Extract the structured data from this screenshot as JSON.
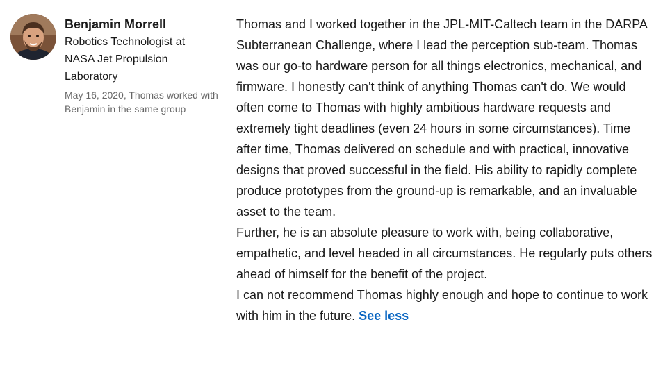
{
  "recommender": {
    "name": "Benjamin Morrell",
    "headline": "Robotics Technologist at NASA Jet Propulsion Laboratory",
    "meta": "May 16, 2020, Thomas worked with Benjamin in the same group",
    "avatar_icon": "profile-photo"
  },
  "recommendation": {
    "paragraphs": [
      "Thomas and I worked together in the JPL-MIT-Caltech team in the DARPA Subterranean Challenge, where I lead the perception sub-team. Thomas was our go-to hardware person for all things electronics, mechanical, and firmware. I honestly can't think of anything Thomas can't do. We would often come to Thomas with highly ambitious hardware requests and extremely tight deadlines (even 24 hours in some circumstances). Time after time, Thomas delivered on schedule and with practical, innovative designs that proved successful in the field. His ability to rapidly complete produce prototypes from the ground-up is remarkable, and an invaluable asset to the team.",
      "Further, he is an absolute pleasure to work with, being collaborative, empathetic, and level headed in all circumstances. He regularly puts others ahead of himself for the benefit of the project.",
      "I can not recommend Thomas highly enough and hope to continue to work with him in the future."
    ],
    "see_less_label": "See less"
  },
  "colors": {
    "link": "#0a66c2",
    "text_primary": "rgba(0,0,0,0.9)",
    "text_secondary": "rgba(0,0,0,0.6)"
  }
}
